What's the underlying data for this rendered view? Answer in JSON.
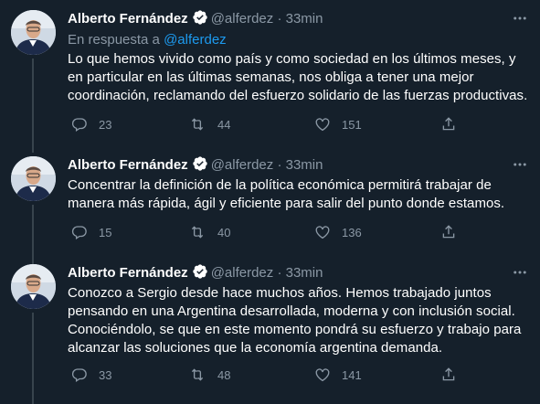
{
  "tweets": [
    {
      "name": "Alberto Fernández",
      "handle": "@alferdez",
      "dot": "·",
      "time": "33min",
      "reply_prefix": "En respuesta a",
      "reply_mention": "@alferdez",
      "text": "Lo que hemos vivido como país y como sociedad en los últimos meses, y en particular en las últimas semanas, nos obliga a tener una mejor coordinación, reclamando del esfuerzo solidario de las fuerzas productivas.",
      "replies": "23",
      "retweets": "44",
      "likes": "151"
    },
    {
      "name": "Alberto Fernández",
      "handle": "@alferdez",
      "dot": "·",
      "time": "33min",
      "text": "Concentrar la definición de la política económica permitirá trabajar de manera más rápida, ágil y eficiente para salir del punto donde estamos.",
      "replies": "15",
      "retweets": "40",
      "likes": "136"
    },
    {
      "name": "Alberto Fernández",
      "handle": "@alferdez",
      "dot": "·",
      "time": "33min",
      "text": "Conozco a Sergio desde hace muchos años. Hemos trabajado juntos pensando en una Argentina desarrollada, moderna y con inclusión social. Conociéndolo, se que en este momento pondrá su esfuerzo y trabajo para alcanzar las soluciones que la economía argentina demanda.",
      "replies": "33",
      "retweets": "48",
      "likes": "141"
    }
  ],
  "colors": {
    "background": "#15202b",
    "muted": "#8b98a5",
    "accent": "#1d9bf0",
    "thread_line": "#38444d"
  },
  "icons": [
    "more-icon",
    "verified-icon",
    "reply-icon",
    "retweet-icon",
    "like-icon",
    "share-icon"
  ]
}
